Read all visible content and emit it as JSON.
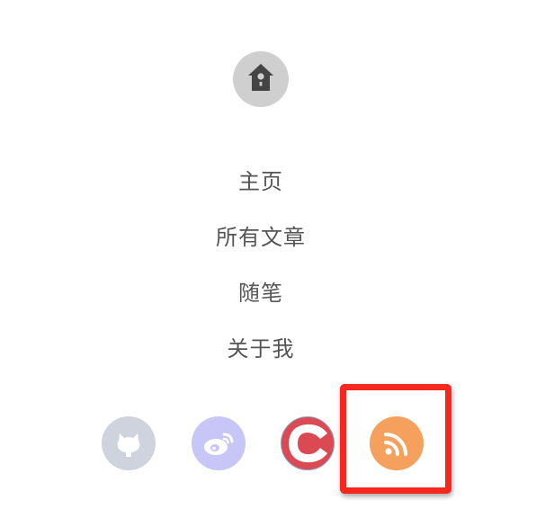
{
  "logo": {
    "icon": "birdhouse-icon",
    "color": "#cfcfcf"
  },
  "nav": {
    "items": [
      {
        "label": "主页"
      },
      {
        "label": "所有文章"
      },
      {
        "label": "随笔"
      },
      {
        "label": "关于我"
      }
    ]
  },
  "social": {
    "items": [
      {
        "icon": "github-icon",
        "color": "#cfd3de"
      },
      {
        "icon": "weibo-icon",
        "color": "#c7c6f7"
      },
      {
        "icon": "csdn-icon",
        "color": "#db4a52"
      },
      {
        "icon": "rss-icon",
        "color": "#f5a05c"
      }
    ]
  },
  "highlight": {
    "color": "#f5271e"
  }
}
